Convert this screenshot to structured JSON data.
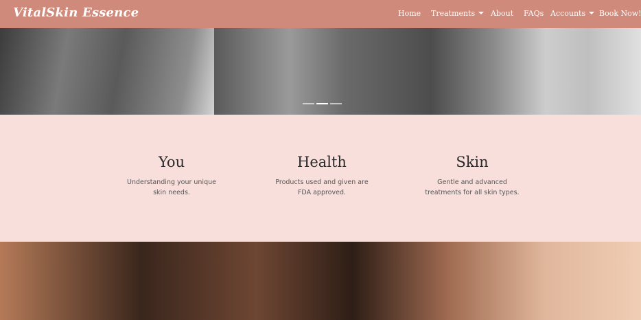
{
  "brand": "VitalSkin Essence",
  "nav": {
    "home": "Home",
    "treatments": "Treatments",
    "about": "About",
    "faqs": "FAQs",
    "accounts": "Accounts",
    "book": "Book Now!"
  },
  "carousel": {
    "slides": 3,
    "active": 1
  },
  "features": [
    {
      "title": "You",
      "desc_line1": "Understanding your unique",
      "desc_line2": "skin needs."
    },
    {
      "title": "Health",
      "desc_line1": "Products used and given are",
      "desc_line2": "FDA approved."
    },
    {
      "title": "Skin",
      "desc_line1": "Gentle and advanced",
      "desc_line2": "treatments for all skin types."
    }
  ],
  "colors": {
    "navbar": "#d08a7b",
    "features_bg": "#f8dfdc"
  }
}
